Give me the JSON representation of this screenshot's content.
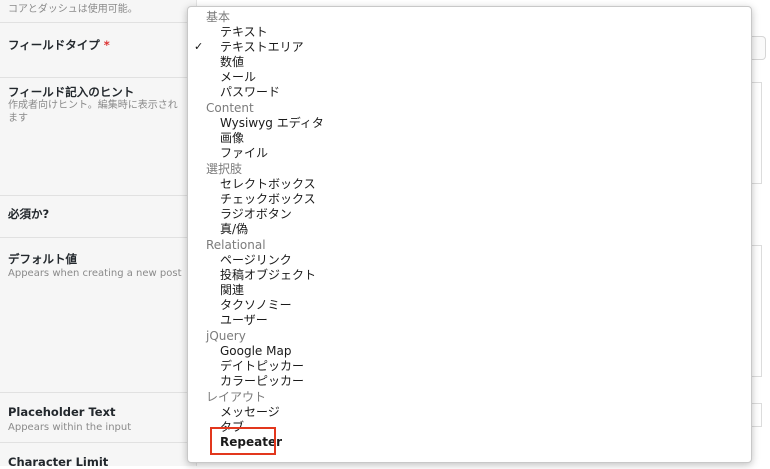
{
  "top_hint": "コアとダッシュは使用可能。",
  "labels": {
    "field_type": "フィールドタイプ",
    "required_mark": "*",
    "hint_title": "フィールド記入のヒント",
    "hint_desc": "作成者向けヒント。編集時に表示されます",
    "required_q": "必須か?",
    "default_title": "デフォルト値",
    "default_desc": "Appears when creating a new post",
    "placeholder_title": "Placeholder Text",
    "placeholder_desc": "Appears within the input",
    "charlimit_title": "Character Limit"
  },
  "dropdown": {
    "selected_mark": "✓",
    "groups": [
      {
        "label": "基本",
        "items": [
          "テキスト",
          "テキストエリア",
          "数値",
          "メール",
          "パスワード"
        ]
      },
      {
        "label": "Content",
        "items": [
          "Wysiwyg エディタ",
          "画像",
          "ファイル"
        ]
      },
      {
        "label": "選択肢",
        "items": [
          "セレクトボックス",
          "チェックボックス",
          "ラジオボタン",
          "真/偽"
        ]
      },
      {
        "label": "Relational",
        "items": [
          "ページリンク",
          "投稿オブジェクト",
          "関連",
          "タクソノミー",
          "ユーザー"
        ]
      },
      {
        "label": "jQuery",
        "items": [
          "Google Map",
          "デイトピッカー",
          "カラーピッカー"
        ]
      },
      {
        "label": "レイアウト",
        "items": [
          "メッセージ",
          "タブ",
          "Repeater"
        ]
      }
    ]
  },
  "colors": {
    "highlight_border": "#e2371d",
    "required": "#dc3232"
  }
}
